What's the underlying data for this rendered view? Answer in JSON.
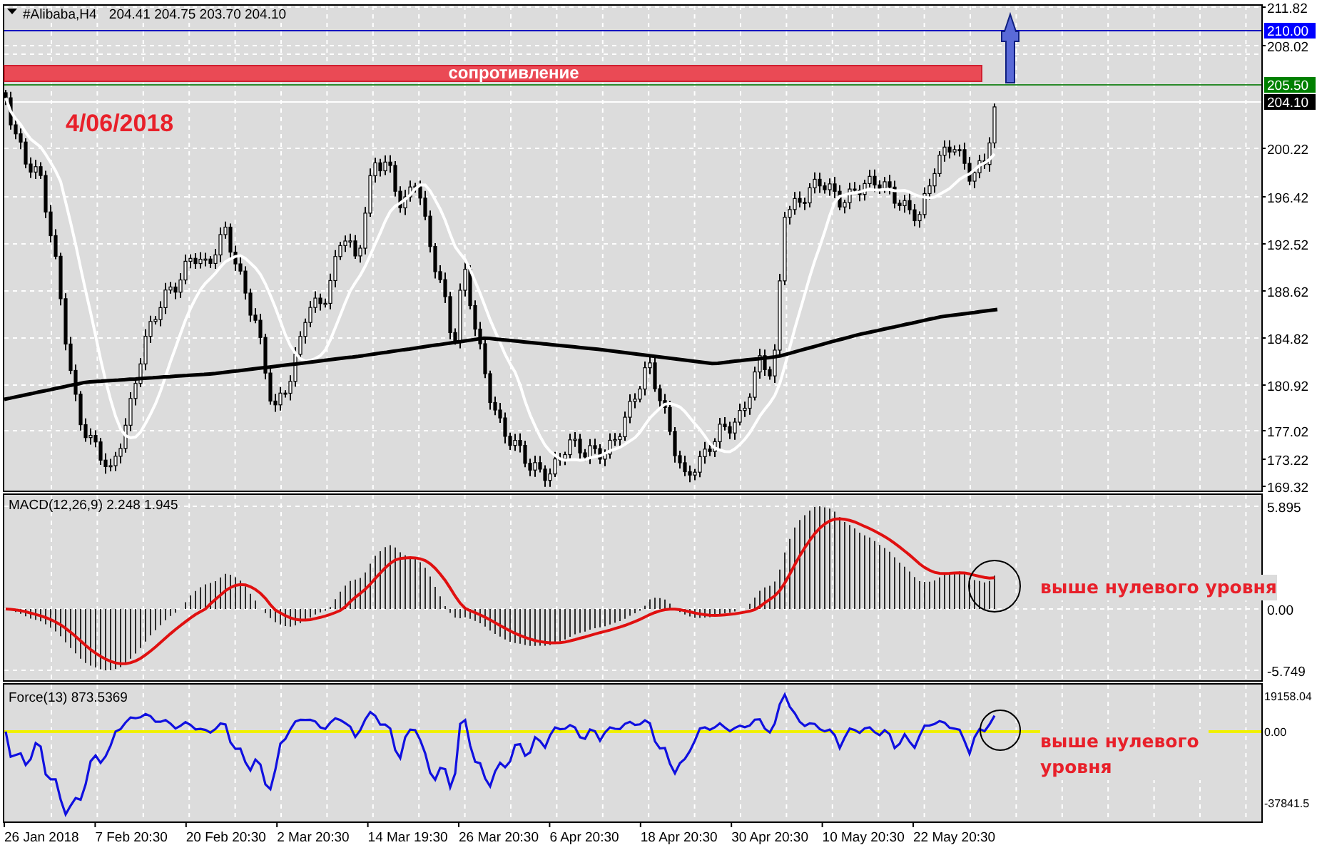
{
  "header": {
    "symbol": "#Alibaba,H4",
    "quotes": "204.41 204.75 203.70 204.10"
  },
  "resistance": {
    "label": "сопротивление"
  },
  "date_label": "4/06/2018",
  "price_axis": {
    "ticks": [
      "211.82",
      "208.02",
      "200.22",
      "196.42",
      "192.52",
      "188.62",
      "184.82",
      "180.92",
      "177.02",
      "173.22",
      "169.32"
    ],
    "markers": [
      {
        "text": "210.00",
        "color": "#0000ff"
      },
      {
        "text": "205.50",
        "color": "#008000"
      },
      {
        "text": "204.10",
        "color": "#000000"
      }
    ]
  },
  "macd": {
    "title": "MACD(12,26,9) 2.248 1.945",
    "ticks": [
      "5.895",
      "0.00",
      "-5.749"
    ],
    "note": "выше нулевого уровня"
  },
  "force": {
    "title": "Force(13) 873.5369",
    "ticks": [
      "19158.04",
      "0.00",
      "-37841.5"
    ],
    "note": "выше нулевого уровня"
  },
  "time_axis": [
    "26 Jan 2018",
    "7 Feb 20:30",
    "20 Feb 20:30",
    "2 Mar 20:30",
    "14 Mar 19:30",
    "26 Mar 20:30",
    "6 Apr 20:30",
    "18 Apr 20:30",
    "30 Apr 20:30",
    "10 May 20:30",
    "22 May 20:30"
  ]
}
